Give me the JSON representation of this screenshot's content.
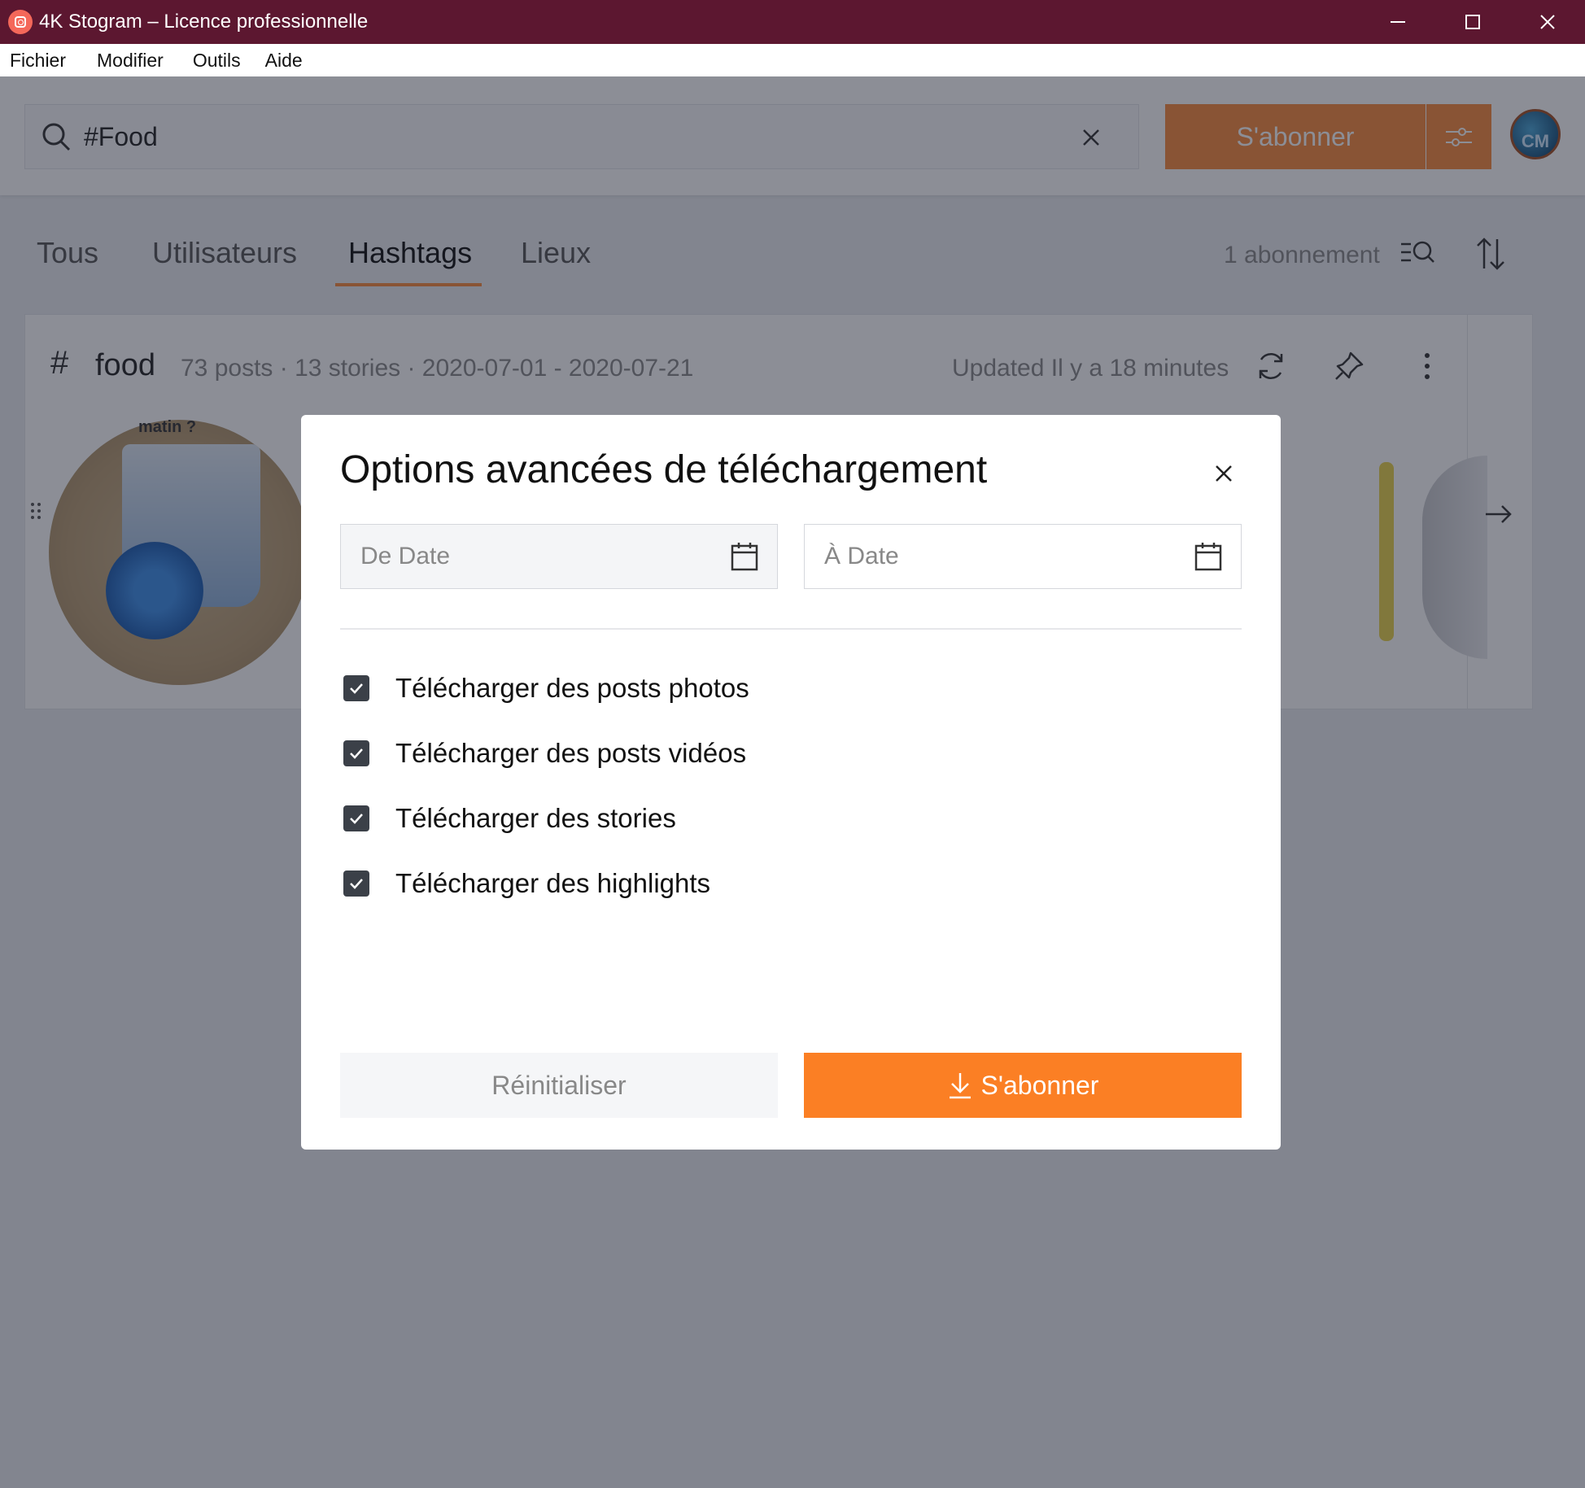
{
  "window": {
    "title": "4K Stogram – Licence professionnelle"
  },
  "menu": [
    "Fichier",
    "Modifier",
    "Outils",
    "Aide"
  ],
  "search": {
    "value": "#Food"
  },
  "topbar": {
    "subscribe_label": "S'abonner",
    "avatar_initials": "CM"
  },
  "tabs": [
    {
      "label": "Tous",
      "active": false
    },
    {
      "label": "Utilisateurs",
      "active": false
    },
    {
      "label": "Hashtags",
      "active": true
    },
    {
      "label": "Lieux",
      "active": false
    }
  ],
  "subscriptions_count": "1 abonnement",
  "card": {
    "hash_symbol": "#",
    "name": "food",
    "meta": "73 posts · 13 stories · 2020-07-01 - 2020-07-21",
    "updated": "Updated Il y a 18 minutes",
    "thumb_caption": "matin ?"
  },
  "modal": {
    "title": "Options avancées de téléchargement",
    "from_date_placeholder": "De Date",
    "to_date_placeholder": "À Date",
    "options": [
      {
        "label": "Télécharger des posts photos",
        "checked": true
      },
      {
        "label": "Télécharger des posts vidéos",
        "checked": true
      },
      {
        "label": "Télécharger des stories",
        "checked": true
      },
      {
        "label": "Télécharger des highlights",
        "checked": true
      }
    ],
    "reset_label": "Réinitialiser",
    "confirm_label": "S'abonner"
  },
  "colors": {
    "titlebar": "#5c1730",
    "accent": "#fb7f24",
    "tab_underline": "#f88a3c"
  }
}
